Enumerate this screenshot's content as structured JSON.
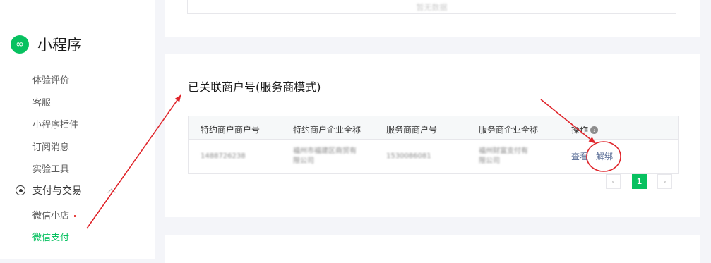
{
  "sidebar": {
    "brand_icon": "∞",
    "brand_name": "小程序",
    "items": [
      "体验评价",
      "客服",
      "小程序插件",
      "订阅消息",
      "实验工具"
    ],
    "group_label": "支付与交易",
    "sub_items": [
      "微信小店",
      "微信支付"
    ],
    "active_item": "微信支付"
  },
  "top_card": {
    "empty_text": "暂无数据"
  },
  "section": {
    "title": "已关联商户号(服务商模式)",
    "columns": [
      "特约商户商户号",
      "特约商户企业全称",
      "服务商商户号",
      "服务商企业全称",
      "操作"
    ],
    "help_icon": "?",
    "rows": [
      {
        "merchant_id": "1488726238",
        "merchant_name": "福州市福建区商贸有限公司",
        "provider_id": "1530086081",
        "provider_name": "福州财富支付有限公司",
        "action_view": "查看",
        "action_unbind": "解绑"
      }
    ],
    "pagination": {
      "prev": "‹",
      "current": "1",
      "next": "›"
    }
  },
  "colors": {
    "accent": "#07c160",
    "link": "#576b95",
    "annotation": "#e0252b"
  }
}
